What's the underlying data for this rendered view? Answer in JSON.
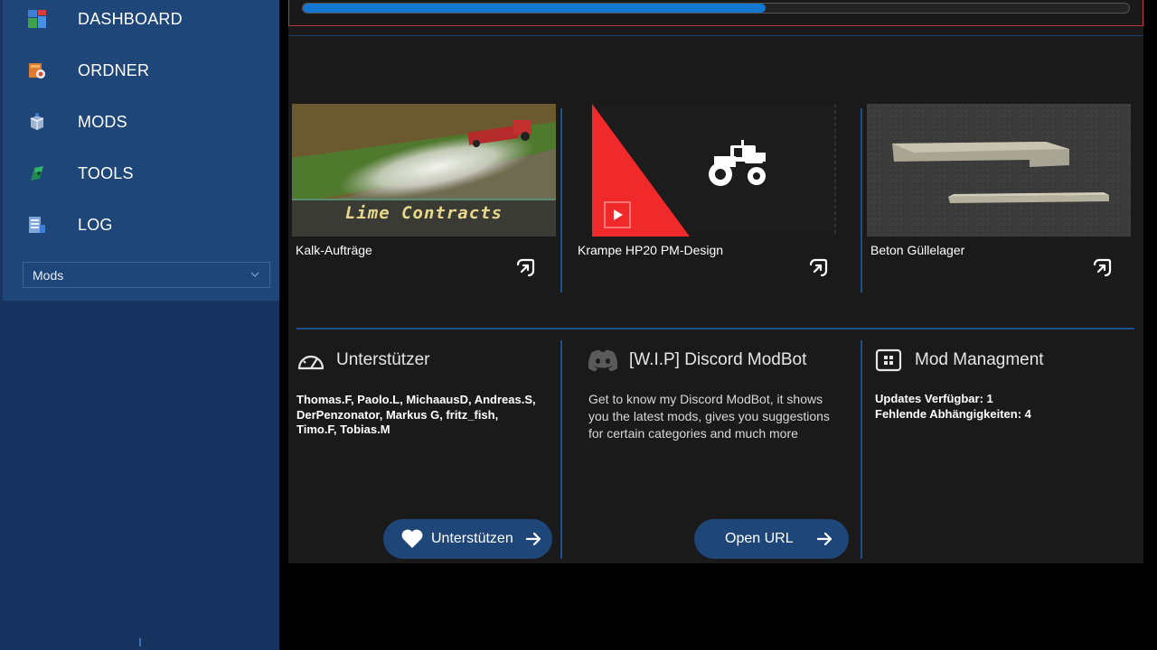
{
  "sidebar": {
    "items": [
      {
        "label": "DASHBOARD",
        "icon": "dashboard-icon"
      },
      {
        "label": "ORDNER",
        "icon": "folder-icon"
      },
      {
        "label": "MODS",
        "icon": "mods-icon"
      },
      {
        "label": "TOOLS",
        "icon": "tools-icon"
      },
      {
        "label": "LOG",
        "icon": "log-icon"
      }
    ],
    "select_value": "Mods"
  },
  "progress": {
    "fraction": 0.56
  },
  "cards": [
    {
      "title": "Kalk-Aufträge",
      "banner": "Lime Contracts"
    },
    {
      "title": "Krampe HP20 PM-Design"
    },
    {
      "title": "Beton Güllelager"
    }
  ],
  "panels": {
    "supporters": {
      "title": "Unterstützer",
      "lines": [
        "Thomas.F, Paolo.L, MichaausD, Andreas.S,",
        "DerPenzonator, Markus G, fritz_fish,",
        "Timo.F, Tobias.M"
      ],
      "button_label": "Unterstützen"
    },
    "discord": {
      "title": "[W.I.P] Discord ModBot",
      "lines": [
        "Get to know my Discord ModBot, it shows",
        "you the latest mods, gives you suggestions",
        "for certain categories and much more"
      ],
      "button_label": "Open URL"
    },
    "management": {
      "title": "Mod Managment",
      "lines": [
        "Updates Verfügbar: 1",
        "Fehlende Abhängigkeiten: 4"
      ]
    }
  },
  "colors": {
    "accent": "#1376cf",
    "sidebar": "#1e4679",
    "panel": "#1a1a1a",
    "divider": "#1d4f8a",
    "alert_border": "#c0393b"
  }
}
